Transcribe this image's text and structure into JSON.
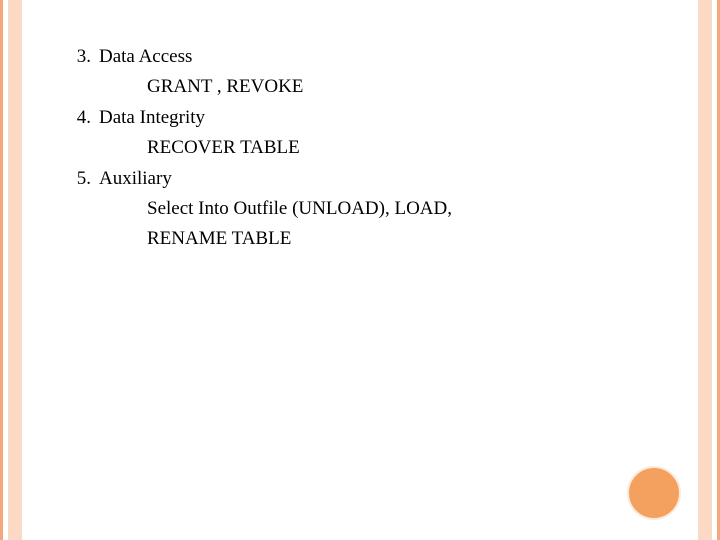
{
  "slide": {
    "items": [
      {
        "number": "3.",
        "title": "Data Access",
        "subs": [
          "GRANT , REVOKE"
        ]
      },
      {
        "number": "4.",
        "title": "Data Integrity",
        "subs": [
          "RECOVER TABLE"
        ]
      },
      {
        "number": "5.",
        "title": "Auxiliary",
        "subs": [
          "Select Into Outfile (UNLOAD), LOAD,",
          "RENAME TABLE"
        ]
      }
    ]
  }
}
